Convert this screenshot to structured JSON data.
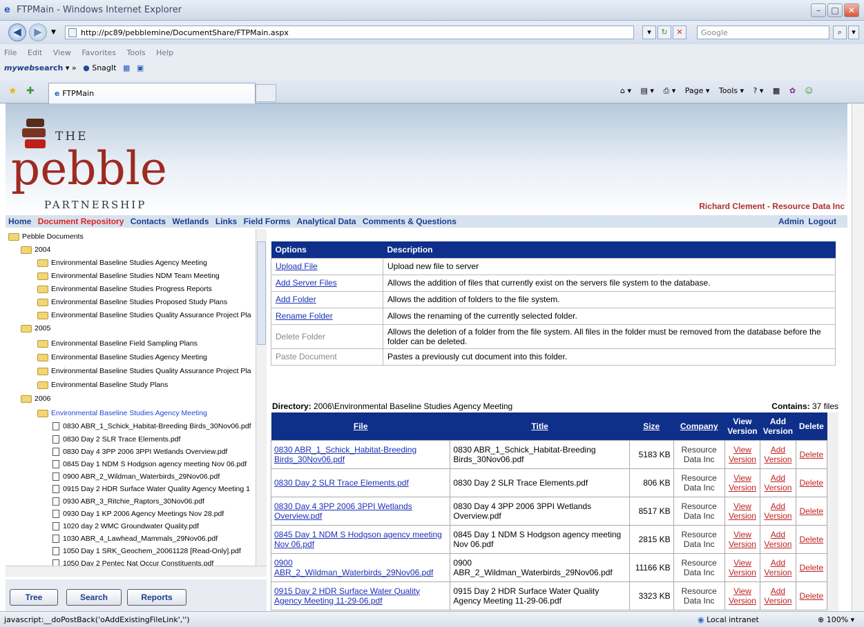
{
  "window": {
    "title": "FTPMain - Windows Internet Explorer"
  },
  "address": {
    "url": "http://pc89/pebblemine/DocumentShare/FTPMain.aspx",
    "search_placeholder": "Google"
  },
  "menu": [
    "File",
    "Edit",
    "View",
    "Favorites",
    "Tools",
    "Help"
  ],
  "toolbar": {
    "brand": "myweb",
    "brand2": "search",
    "snagit": "SnagIt"
  },
  "tab": {
    "label": "FTPMain"
  },
  "commandbar": {
    "page": "Page ▾",
    "tools": "Tools ▾"
  },
  "header": {
    "logo_the": "THE",
    "logo_name": "pebble",
    "logo_sub": "PARTNERSHIP",
    "user": "Richard Clement - Resource Data Inc"
  },
  "sitenav": {
    "items": [
      "Home",
      "Document Repository",
      "Contacts",
      "Wetlands",
      "Links",
      "Field Forms",
      "Analytical Data",
      "Comments & Questions"
    ],
    "admin": "Admin",
    "logout": "Logout"
  },
  "tree": {
    "root": "Pebble Documents",
    "y2004": "2004",
    "y2004_items": [
      "Environmental Baseline Studies Agency Meeting",
      "Environmental Baseline Studies NDM Team Meeting",
      "Environmental Baseline Studies Progress Reports",
      "Environmental Baseline Studies Proposed Study Plans",
      "Environmental Baseline Studies Quality Assurance Project Pla"
    ],
    "y2005": "2005",
    "y2005_items": [
      "Environmental Baseline Field Sampling Plans",
      "Environmental Baseline Studies Agency Meeting",
      "Environmental Baseline Studies Quality Assurance Project Pla",
      "Environmental Baseline Study Plans"
    ],
    "y2006": "2006",
    "y2006_sel": "Environmental Baseline Studies Agency Meeting",
    "docs": [
      "0830 ABR_1_Schick_Habitat-Breeding Birds_30Nov06.pdf",
      "0830 Day 2 SLR Trace Elements.pdf",
      "0830 Day 4 3PP 2006 3PPI Wetlands Overview.pdf",
      "0845 Day 1 NDM S Hodgson agency meeting Nov 06.pdf",
      "0900 ABR_2_Wildman_Waterbirds_29Nov06.pdf",
      "0915 Day 2 HDR Surface Water Quality Agency Meeting 1",
      "0930 ABR_3_Ritchie_Raptors_30Nov06.pdf",
      "0930 Day 1 KP 2006 Agency Meetings Nov 28.pdf",
      "1020 day 2 WMC Groundwater Quality.pdf",
      "1030 ABR_4_Lawhead_Mammals_29Nov06.pdf",
      "1050 Day 1 SRK_Geochem_20061128 [Read-Only].pdf",
      "1050 Day 2 Pentec Nat Occur Constituents.pdf"
    ]
  },
  "buttons": {
    "tree": "Tree",
    "search": "Search",
    "reports": "Reports"
  },
  "options": {
    "h1": "Options",
    "h2": "Description",
    "rows": [
      {
        "o": "Upload File",
        "d": "Upload new file to server"
      },
      {
        "o": "Add Server Files",
        "d": "Allows the addition of files that currently exist on the servers file system to the database."
      },
      {
        "o": "Add Folder",
        "d": "Allows the addition of folders to the file system."
      },
      {
        "o": "Rename Folder",
        "d": "Allows the renaming of the currently selected folder."
      },
      {
        "o": "Delete Folder",
        "d": "Allows the deletion of a folder from the file system. All files in the folder must be removed from the database before the folder can be deleted."
      },
      {
        "o": "Paste Document",
        "d": "Pastes a previously cut document into this folder."
      }
    ]
  },
  "directory": {
    "label": "Directory:",
    "path": "2006\\Environmental Baseline Studies Agency Meeting",
    "contains_label": "Contains:",
    "contains": "37 files"
  },
  "files": {
    "headers": [
      "File",
      "Title",
      "Size",
      "Company",
      "View Version",
      "Add Version",
      "Delete"
    ],
    "rows": [
      {
        "f": "0830 ABR_1_Schick_Habitat-Breeding Birds_30Nov06.pdf",
        "t": "0830 ABR_1_Schick_Habitat-Breeding Birds_30Nov06.pdf",
        "s": "5183 KB"
      },
      {
        "f": "0830 Day 2 SLR Trace Elements.pdf",
        "t": "0830 Day 2 SLR Trace Elements.pdf",
        "s": "806 KB"
      },
      {
        "f": "0830 Day 4 3PP 2006 3PPI Wetlands Overview.pdf",
        "t": "0830 Day 4 3PP 2006 3PPI Wetlands Overview.pdf",
        "s": "8517 KB"
      },
      {
        "f": "0845 Day 1 NDM S Hodgson agency meeting Nov 06.pdf",
        "t": "0845 Day 1 NDM S Hodgson agency meeting Nov 06.pdf",
        "s": "2815 KB"
      },
      {
        "f": "0900 ABR_2_Wildman_Waterbirds_29Nov06.pdf",
        "t": "0900 ABR_2_Wildman_Waterbirds_29Nov06.pdf",
        "s": "11166 KB"
      },
      {
        "f": "0915 Day 2 HDR Surface Water Quality Agency Meeting 11-29-06.pdf",
        "t": "0915 Day 2 HDR Surface Water Quality Agency Meeting 11-29-06.pdf",
        "s": "3323 KB"
      }
    ],
    "company": "Resource Data Inc",
    "view": "View Version",
    "add": "Add Version",
    "delete": "Delete"
  },
  "status": {
    "text": "javascript:__doPostBack('oAddExistingFileLink','')",
    "zone": "Local intranet",
    "zoom": "100%"
  }
}
